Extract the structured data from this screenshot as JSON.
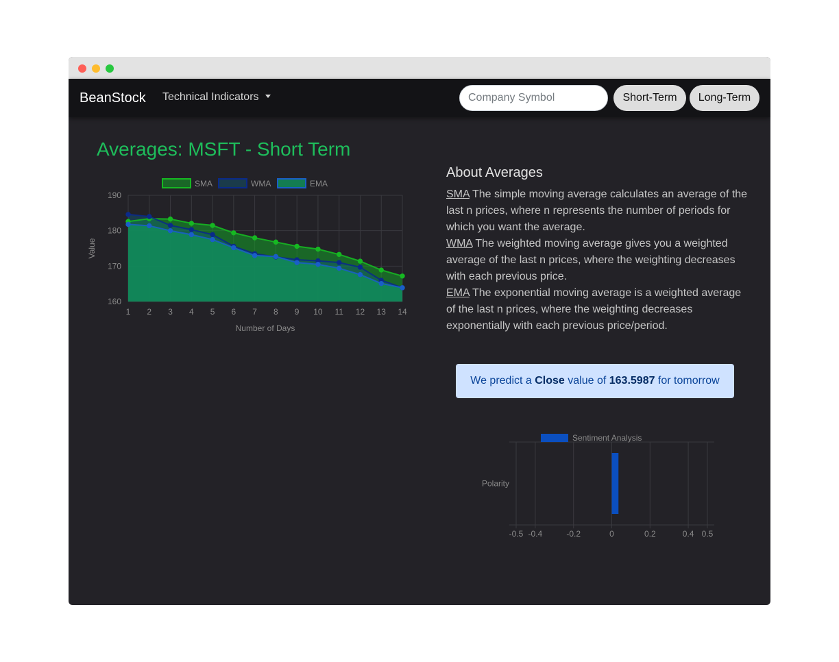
{
  "navbar": {
    "brand": "BeanStock",
    "dropdown_label": "Technical Indicators",
    "search_placeholder": "Company Symbol",
    "short_term_label": "Short-Term",
    "long_term_label": "Long-Term"
  },
  "main": {
    "title": "Averages: MSFT - Short Term"
  },
  "about": {
    "heading": "About Averages",
    "items": [
      {
        "term": "SMA",
        "text": " The simple moving average calculates an average of the last n prices, where n represents the number of periods for which you want the average."
      },
      {
        "term": "WMA",
        "text": " The weighted moving average gives you a weighted average of the last n prices, where the weighting decreases with each previous price."
      },
      {
        "term": "EMA",
        "text": " The exponential moving average is a weighted average of the last n prices, where the weighting decreases exponentially with each previous price/period."
      }
    ]
  },
  "prediction": {
    "prefix": "We predict a ",
    "field": "Close",
    "middle": " value of ",
    "value": "163.5987",
    "suffix": " for tomorrow"
  },
  "colors": {
    "title_green": "#1ebd5b",
    "sma": "#16b822",
    "wma": "#0a2a8a",
    "ema": "#1a5fc7",
    "area_fill": "#0f8a52",
    "sentiment_bar": "#0b4fbf",
    "alert_bg": "#cfe2ff"
  },
  "chart_data": [
    {
      "type": "line",
      "title": "",
      "xlabel": "Number of Days",
      "ylabel": "Value",
      "x": [
        1,
        2,
        3,
        4,
        5,
        6,
        7,
        8,
        9,
        10,
        11,
        12,
        13,
        14
      ],
      "ylim": [
        160,
        190
      ],
      "yticks": [
        160,
        170,
        180,
        190
      ],
      "grid": true,
      "fill": true,
      "legend": "top",
      "series": [
        {
          "name": "SMA",
          "values": [
            182.6,
            183.4,
            183.3,
            182.1,
            181.5,
            179.4,
            178.0,
            176.8,
            175.6,
            174.8,
            173.3,
            171.4,
            168.9,
            167.2
          ]
        },
        {
          "name": "WMA",
          "values": [
            184.6,
            184.0,
            181.5,
            180.3,
            178.9,
            175.6,
            173.5,
            172.6,
            171.8,
            171.5,
            171.0,
            169.7,
            166.0,
            163.9
          ]
        },
        {
          "name": "EMA",
          "values": [
            181.8,
            181.4,
            180.0,
            178.9,
            177.5,
            175.2,
            173.0,
            172.7,
            171.0,
            170.5,
            169.4,
            167.6,
            165.1,
            163.9
          ]
        }
      ]
    },
    {
      "type": "bar",
      "orientation": "horizontal",
      "categories": [
        "Polarity"
      ],
      "series": [
        {
          "name": "Sentiment Analysis",
          "values": [
            0.035
          ]
        }
      ],
      "xlim": [
        -0.5,
        0.5
      ],
      "xticks": [
        -0.5,
        -0.4,
        -0.2,
        0,
        0.2,
        0.4,
        0.5
      ],
      "grid": true,
      "legend": "top"
    }
  ]
}
